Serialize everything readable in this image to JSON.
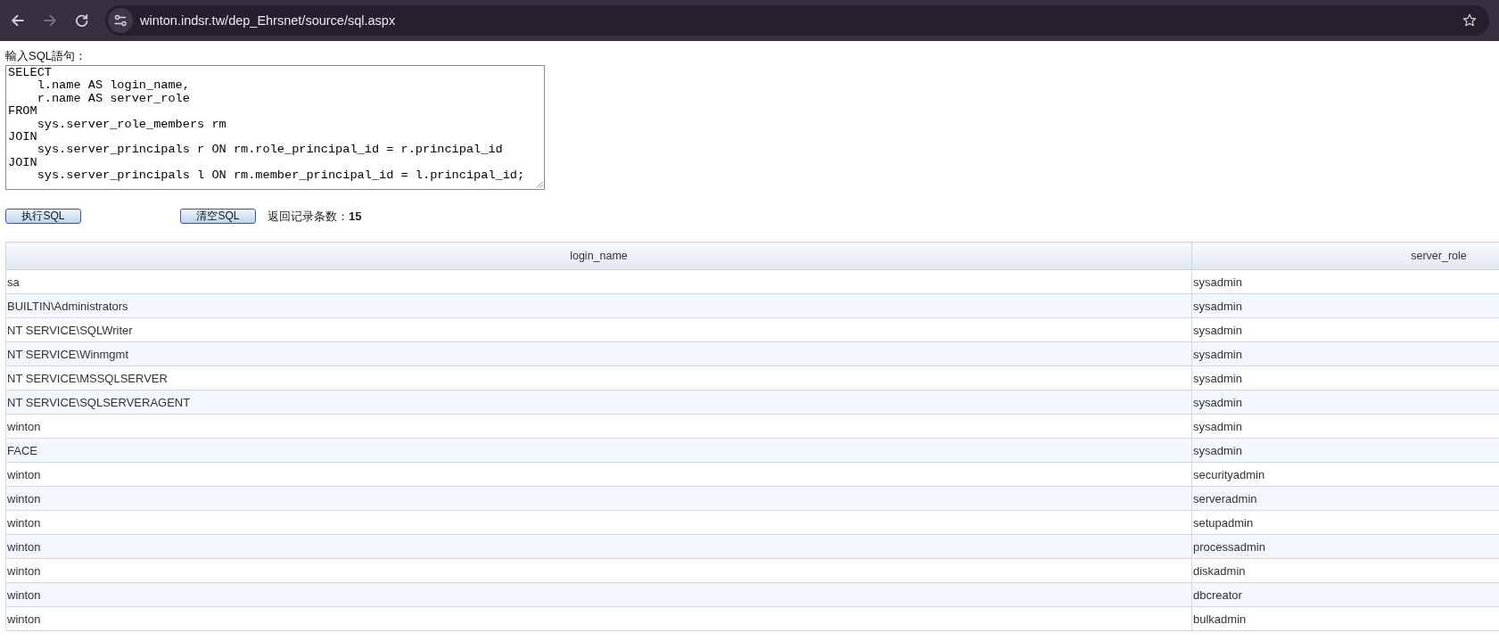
{
  "browser": {
    "nav_buttons": [
      {
        "kind": "back",
        "disabled": false
      },
      {
        "kind": "forward",
        "disabled": true
      },
      {
        "kind": "reload",
        "disabled": false
      }
    ],
    "url": "winton.indsr.tw/dep_Ehrsnet/source/sql.aspx"
  },
  "sql_form": {
    "label": "輸入SQL語句：",
    "query": "SELECT\n    l.name AS login_name,\n    r.name AS server_role\nFROM\n    sys.server_role_members rm\nJOIN\n    sys.server_principals r ON rm.role_principal_id = r.principal_id\nJOIN\n    sys.server_principals l ON rm.member_principal_id = l.principal_id;"
  },
  "actions": {
    "execute_button": "执行SQL",
    "clear_button": "清空SQL",
    "record_count": "返回记录条数：**15**"
  },
  "table": {
    "columns": [
      "login_name",
      "server_role"
    ],
    "rows": [
      [
        "sa",
        "sysadmin"
      ],
      [
        "BUILTIN\\Administrators",
        "sysadmin"
      ],
      [
        "NT SERVICE\\SQLWriter",
        "sysadmin"
      ],
      [
        "NT SERVICE\\Winmgmt",
        "sysadmin"
      ],
      [
        "NT SERVICE\\MSSQLSERVER",
        "sysadmin"
      ],
      [
        "NT SERVICE\\SQLSERVERAGENT",
        "sysadmin"
      ],
      [
        "winton",
        "sysadmin"
      ],
      [
        "FACE",
        "sysadmin"
      ],
      [
        "winton",
        "securityadmin"
      ],
      [
        "winton",
        "serveradmin"
      ],
      [
        "winton",
        "setupadmin"
      ],
      [
        "winton",
        "processadmin"
      ],
      [
        "winton",
        "diskadmin"
      ],
      [
        "winton",
        "dbcreator"
      ],
      [
        "winton",
        "bulkadmin"
      ]
    ]
  }
}
